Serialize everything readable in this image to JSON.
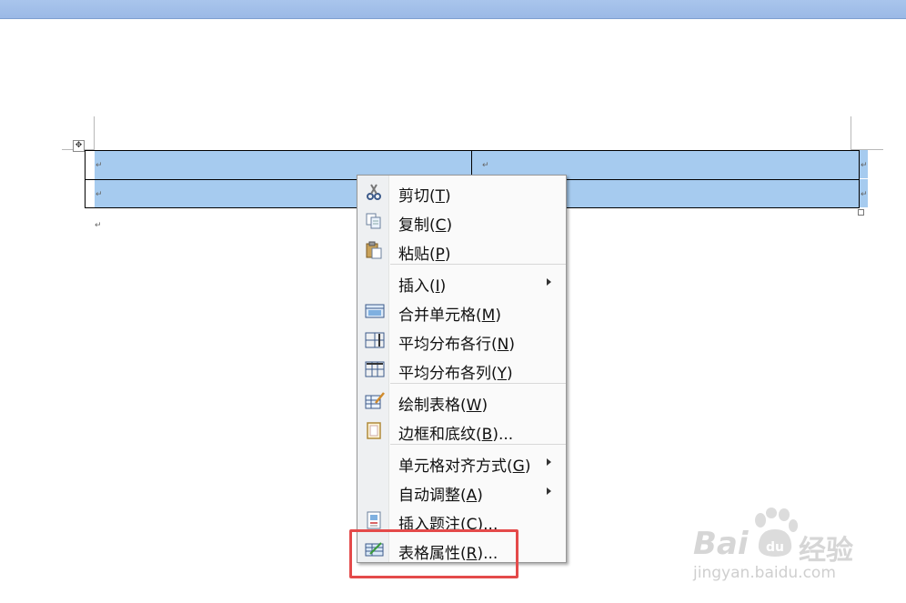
{
  "menu": {
    "items": [
      {
        "text": "剪切(",
        "key": "T",
        "close": ")",
        "icon": "scissors-icon"
      },
      {
        "text": "复制(",
        "key": "C",
        "close": ")",
        "icon": "copy-icon"
      },
      {
        "text": "粘贴(",
        "key": "P",
        "close": ")",
        "icon": "paste-icon"
      },
      {
        "text": "插入(",
        "key": "I",
        "close": ")",
        "icon": "",
        "submenu": true
      },
      {
        "text": "合并单元格(",
        "key": "M",
        "close": ")",
        "icon": "merge-cells-icon"
      },
      {
        "text": "平均分布各行(",
        "key": "N",
        "close": ")",
        "icon": "distribute-rows-icon"
      },
      {
        "text": "平均分布各列(",
        "key": "Y",
        "close": ")",
        "icon": "distribute-columns-icon"
      },
      {
        "text": "绘制表格(",
        "key": "W",
        "close": ")",
        "icon": "draw-table-icon"
      },
      {
        "text": "边框和底纹(",
        "key": "B",
        "close": ")...",
        "icon": "borders-shading-icon"
      },
      {
        "text": "单元格对齐方式(",
        "key": "G",
        "close": ")",
        "icon": "",
        "submenu": true
      },
      {
        "text": "自动调整(",
        "key": "A",
        "close": ")",
        "icon": "",
        "submenu": true
      },
      {
        "text": "插入题注(",
        "key": "C",
        "close": ")...",
        "icon": "insert-caption-icon"
      },
      {
        "text": "表格属性(",
        "key": "R",
        "close": ")...",
        "icon": "table-properties-icon"
      }
    ]
  },
  "document": {
    "paragraph_mark": "↵",
    "move_handle_glyph": "✥"
  },
  "watermark": {
    "brand": "Bai",
    "brand_cn": "经验",
    "url": "jingyan.baidu.com"
  },
  "colors": {
    "selection": "#a6cbef",
    "highlight_box": "#e44a4a"
  }
}
